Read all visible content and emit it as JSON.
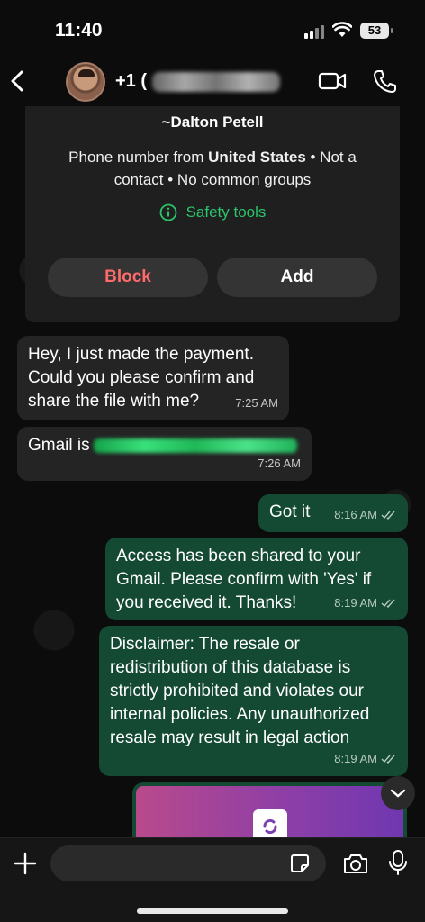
{
  "status_bar": {
    "time": "11:40",
    "battery": "53"
  },
  "header": {
    "contact_prefix": "+1 ("
  },
  "info_card": {
    "name": "~Dalton Petell",
    "line_prefix": "Phone number from ",
    "country": "United States",
    "line_suffix": " • Not a contact • No common groups",
    "safety_tools": "Safety tools",
    "block_label": "Block",
    "add_label": "Add"
  },
  "messages": [
    {
      "text": "Hey, I just made the payment. Could you please confirm and share the file with me?",
      "time": "7:25 AM"
    },
    {
      "text": "Gmail is",
      "time": "7:26 AM"
    },
    {
      "text": "Got it",
      "time": "8:16 AM"
    },
    {
      "text": "Access has been shared to your Gmail. Please confirm with 'Yes' if you received it. Thanks!",
      "time": "8:19 AM"
    },
    {
      "text": "Disclaimer: The resale or redistribution of this database is strictly prohibited and violates our internal policies. Any unauthorized resale may result in legal action",
      "time": "8:19 AM"
    }
  ],
  "colors": {
    "accent_green": "#2bc46b",
    "outgoing_bubble": "#144a33",
    "incoming_bubble": "#242424",
    "block_red": "#ff6a6a"
  }
}
